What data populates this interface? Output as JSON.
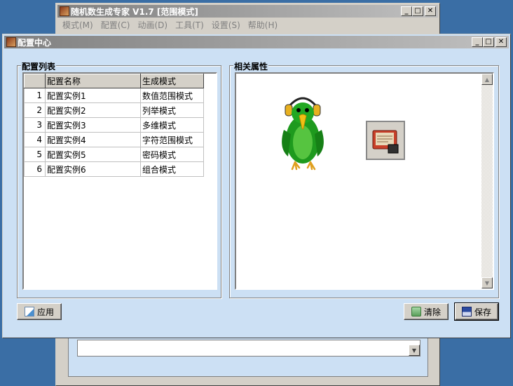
{
  "back_window": {
    "title": "随机数生成专家 V1.7 [范围模式]",
    "menu": [
      "模式(M)",
      "配置(C)",
      "动画(D)",
      "工具(T)",
      "设置(S)",
      "帮助(H)"
    ]
  },
  "main_window": {
    "title": "配置中心"
  },
  "config_list": {
    "label": "配置列表",
    "columns": [
      "",
      "配置名称",
      "生成模式"
    ],
    "rows": [
      {
        "num": "1",
        "name": "配置实例1",
        "mode": "数值范围模式"
      },
      {
        "num": "2",
        "name": "配置实例2",
        "mode": "列举模式"
      },
      {
        "num": "3",
        "name": "配置实例3",
        "mode": "多维模式"
      },
      {
        "num": "4",
        "name": "配置实例4",
        "mode": "字符范围模式"
      },
      {
        "num": "5",
        "name": "配置实例5",
        "mode": "密码模式"
      },
      {
        "num": "6",
        "name": "配置实例6",
        "mode": "组合模式"
      }
    ]
  },
  "properties": {
    "label": "相关属性"
  },
  "buttons": {
    "apply": "应用",
    "clear": "清除",
    "save": "保存"
  },
  "icons": {
    "parrot": "parrot-with-headphones-icon",
    "book": "config-book-icon"
  },
  "colors": {
    "window_bg": "#cce0f4",
    "desktop": "#3a6ea5"
  }
}
